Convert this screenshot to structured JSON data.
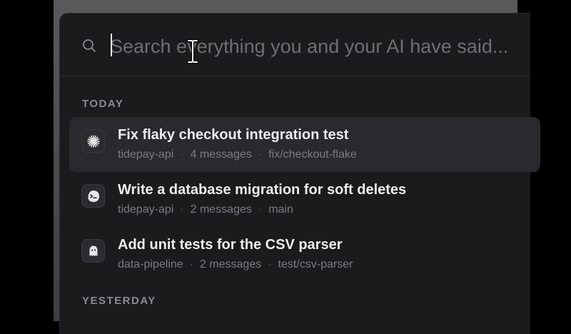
{
  "search": {
    "placeholder": "Search everything you and your AI have said..."
  },
  "sections": [
    {
      "label": "TODAY",
      "items": [
        {
          "title": "Fix flaky checkout integration test",
          "project": "tidepay-api",
          "messages": "4 messages",
          "branch": "fix/checkout-flake",
          "icon": "starburst-icon",
          "selected": true
        },
        {
          "title": "Write a database migration for soft deletes",
          "project": "tidepay-api",
          "messages": "2 messages",
          "branch": "main",
          "icon": "terminal-blob-icon",
          "selected": false
        },
        {
          "title": "Add unit tests for the CSV parser",
          "project": "data-pipeline",
          "messages": "2 messages",
          "branch": "test/csv-parser",
          "icon": "ghost-icon",
          "selected": false
        }
      ]
    },
    {
      "label": "YESTERDAY",
      "items": []
    }
  ],
  "colors": {
    "panel": "#1b1b1e",
    "selected_row": "#2a2a2e",
    "title_text": "#ececec",
    "meta_text": "#7a7a80",
    "section_text": "#8a8a90"
  }
}
